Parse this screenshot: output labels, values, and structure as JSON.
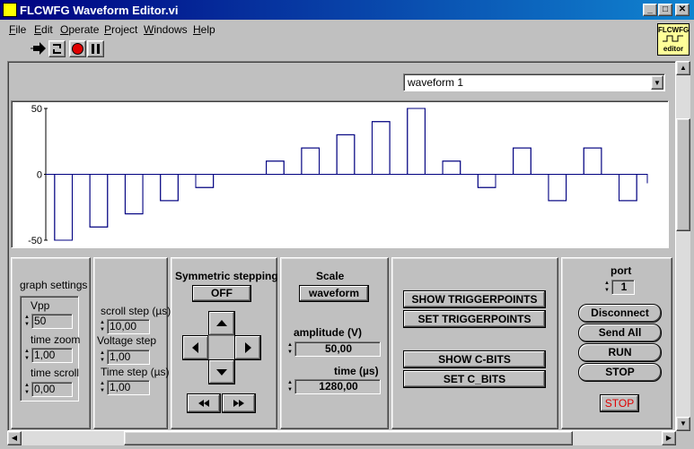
{
  "window": {
    "title": "FLCWFG Waveform Editor.vi",
    "minimize": "_",
    "maximize": "□",
    "close": "✕"
  },
  "menu": [
    {
      "accel": "F",
      "rest": "ile"
    },
    {
      "accel": "E",
      "rest": "dit"
    },
    {
      "accel": "O",
      "rest": "perate"
    },
    {
      "accel": "P",
      "rest": "roject"
    },
    {
      "accel": "W",
      "rest": "indows"
    },
    {
      "accel": "H",
      "rest": "elp"
    }
  ],
  "logo": {
    "line1": "FLCWFG",
    "line2": "editor"
  },
  "waveform_select": {
    "value": "waveform  1"
  },
  "chart_data": {
    "type": "bar",
    "ylim": [
      -50,
      50
    ],
    "yticks": [
      "50",
      "0",
      "-50"
    ],
    "values": [
      -50,
      -40,
      -30,
      -20,
      -10,
      0,
      10,
      20,
      30,
      40,
      50,
      10,
      -10,
      20,
      -20,
      20,
      -20
    ]
  },
  "graph_settings": {
    "title": "graph settings",
    "vpp_label": "Vpp",
    "vpp_value": "50",
    "zoom_label": "time zoom",
    "zoom_value": "1,00",
    "scroll_label": "time scroll",
    "scroll_value": "0,00"
  },
  "steps": {
    "scroll_step_label": "scroll step (µs)",
    "scroll_step_value": "10,00",
    "voltage_step_label": "Voltage step",
    "voltage_step_value": "1,00",
    "time_step_label": "Time step (µs)",
    "time_step_value": "1,00"
  },
  "symmetric": {
    "title": "Symmetric stepping",
    "toggle": "OFF"
  },
  "scale": {
    "title": "Scale",
    "mode": "waveform",
    "amplitude_label": "amplitude (V)",
    "amplitude_value": "50,00",
    "time_label": "time (µs)",
    "time_value": "1280,00"
  },
  "actions": {
    "show_trigger": "SHOW TRIGGERPOINTS",
    "set_trigger": "SET TRIGGERPOINTS",
    "show_cbits": "SHOW C-BITS",
    "set_cbits": "SET C_BITS"
  },
  "port": {
    "label": "port",
    "value": "1",
    "disconnect": "Disconnect",
    "send_all": "Send All",
    "run": "RUN",
    "stop": "STOP",
    "stop_red": "STOP"
  }
}
